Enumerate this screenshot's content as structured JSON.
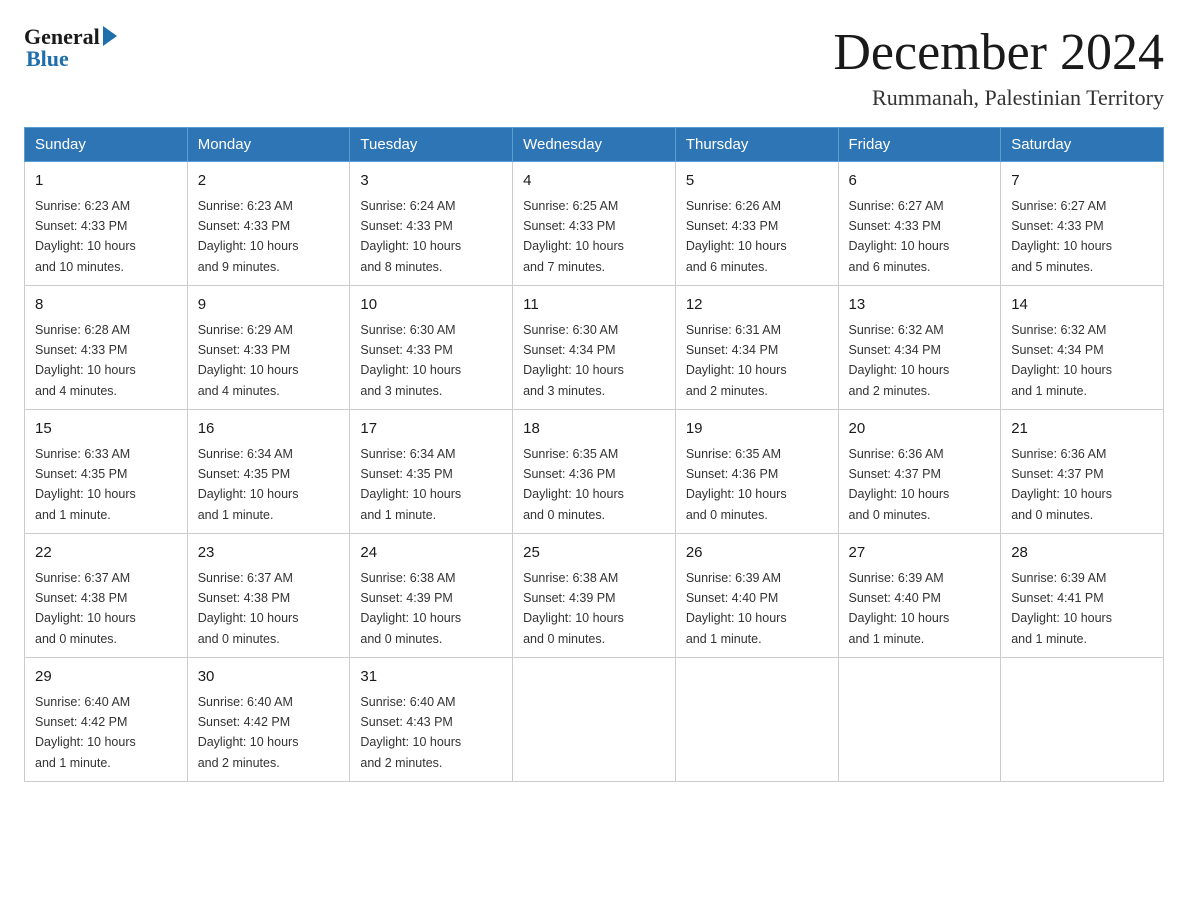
{
  "logo": {
    "general": "General",
    "blue": "Blue"
  },
  "title": {
    "month_year": "December 2024",
    "location": "Rummanah, Palestinian Territory"
  },
  "days_of_week": [
    "Sunday",
    "Monday",
    "Tuesday",
    "Wednesday",
    "Thursday",
    "Friday",
    "Saturday"
  ],
  "weeks": [
    [
      {
        "day": "1",
        "sunrise": "6:23 AM",
        "sunset": "4:33 PM",
        "daylight": "10 hours and 10 minutes."
      },
      {
        "day": "2",
        "sunrise": "6:23 AM",
        "sunset": "4:33 PM",
        "daylight": "10 hours and 9 minutes."
      },
      {
        "day": "3",
        "sunrise": "6:24 AM",
        "sunset": "4:33 PM",
        "daylight": "10 hours and 8 minutes."
      },
      {
        "day": "4",
        "sunrise": "6:25 AM",
        "sunset": "4:33 PM",
        "daylight": "10 hours and 7 minutes."
      },
      {
        "day": "5",
        "sunrise": "6:26 AM",
        "sunset": "4:33 PM",
        "daylight": "10 hours and 6 minutes."
      },
      {
        "day": "6",
        "sunrise": "6:27 AM",
        "sunset": "4:33 PM",
        "daylight": "10 hours and 6 minutes."
      },
      {
        "day": "7",
        "sunrise": "6:27 AM",
        "sunset": "4:33 PM",
        "daylight": "10 hours and 5 minutes."
      }
    ],
    [
      {
        "day": "8",
        "sunrise": "6:28 AM",
        "sunset": "4:33 PM",
        "daylight": "10 hours and 4 minutes."
      },
      {
        "day": "9",
        "sunrise": "6:29 AM",
        "sunset": "4:33 PM",
        "daylight": "10 hours and 4 minutes."
      },
      {
        "day": "10",
        "sunrise": "6:30 AM",
        "sunset": "4:33 PM",
        "daylight": "10 hours and 3 minutes."
      },
      {
        "day": "11",
        "sunrise": "6:30 AM",
        "sunset": "4:34 PM",
        "daylight": "10 hours and 3 minutes."
      },
      {
        "day": "12",
        "sunrise": "6:31 AM",
        "sunset": "4:34 PM",
        "daylight": "10 hours and 2 minutes."
      },
      {
        "day": "13",
        "sunrise": "6:32 AM",
        "sunset": "4:34 PM",
        "daylight": "10 hours and 2 minutes."
      },
      {
        "day": "14",
        "sunrise": "6:32 AM",
        "sunset": "4:34 PM",
        "daylight": "10 hours and 1 minute."
      }
    ],
    [
      {
        "day": "15",
        "sunrise": "6:33 AM",
        "sunset": "4:35 PM",
        "daylight": "10 hours and 1 minute."
      },
      {
        "day": "16",
        "sunrise": "6:34 AM",
        "sunset": "4:35 PM",
        "daylight": "10 hours and 1 minute."
      },
      {
        "day": "17",
        "sunrise": "6:34 AM",
        "sunset": "4:35 PM",
        "daylight": "10 hours and 1 minute."
      },
      {
        "day": "18",
        "sunrise": "6:35 AM",
        "sunset": "4:36 PM",
        "daylight": "10 hours and 0 minutes."
      },
      {
        "day": "19",
        "sunrise": "6:35 AM",
        "sunset": "4:36 PM",
        "daylight": "10 hours and 0 minutes."
      },
      {
        "day": "20",
        "sunrise": "6:36 AM",
        "sunset": "4:37 PM",
        "daylight": "10 hours and 0 minutes."
      },
      {
        "day": "21",
        "sunrise": "6:36 AM",
        "sunset": "4:37 PM",
        "daylight": "10 hours and 0 minutes."
      }
    ],
    [
      {
        "day": "22",
        "sunrise": "6:37 AM",
        "sunset": "4:38 PM",
        "daylight": "10 hours and 0 minutes."
      },
      {
        "day": "23",
        "sunrise": "6:37 AM",
        "sunset": "4:38 PM",
        "daylight": "10 hours and 0 minutes."
      },
      {
        "day": "24",
        "sunrise": "6:38 AM",
        "sunset": "4:39 PM",
        "daylight": "10 hours and 0 minutes."
      },
      {
        "day": "25",
        "sunrise": "6:38 AM",
        "sunset": "4:39 PM",
        "daylight": "10 hours and 0 minutes."
      },
      {
        "day": "26",
        "sunrise": "6:39 AM",
        "sunset": "4:40 PM",
        "daylight": "10 hours and 1 minute."
      },
      {
        "day": "27",
        "sunrise": "6:39 AM",
        "sunset": "4:40 PM",
        "daylight": "10 hours and 1 minute."
      },
      {
        "day": "28",
        "sunrise": "6:39 AM",
        "sunset": "4:41 PM",
        "daylight": "10 hours and 1 minute."
      }
    ],
    [
      {
        "day": "29",
        "sunrise": "6:40 AM",
        "sunset": "4:42 PM",
        "daylight": "10 hours and 1 minute."
      },
      {
        "day": "30",
        "sunrise": "6:40 AM",
        "sunset": "4:42 PM",
        "daylight": "10 hours and 2 minutes."
      },
      {
        "day": "31",
        "sunrise": "6:40 AM",
        "sunset": "4:43 PM",
        "daylight": "10 hours and 2 minutes."
      },
      null,
      null,
      null,
      null
    ]
  ],
  "labels": {
    "sunrise": "Sunrise:",
    "sunset": "Sunset:",
    "daylight": "Daylight:"
  }
}
